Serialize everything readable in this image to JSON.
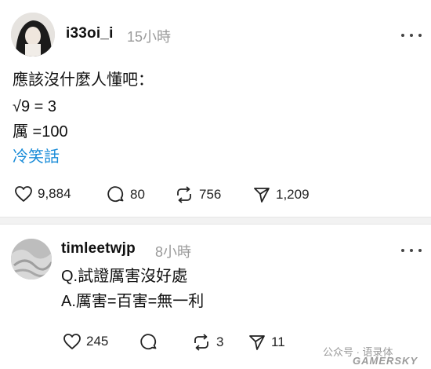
{
  "posts": [
    {
      "username": "i33oi_i",
      "time": "15小時",
      "lines": [
        "應該沒什麼人懂吧：",
        "√9 = 3",
        "厲 =100"
      ],
      "tag": "冷笑話",
      "actions": {
        "likes": "9,884",
        "comments": "80",
        "reposts": "756",
        "shares": "1,209"
      }
    },
    {
      "username": "timleetwjp",
      "time": "8小時",
      "lines": [
        "Q.試證厲害沒好處",
        "A.厲害=百害=無一利"
      ],
      "actions": {
        "likes": "245",
        "comments": "",
        "reposts": "3",
        "shares": "11"
      }
    }
  ],
  "watermark": {
    "source": "公众号 · 语录体",
    "brand": "GAMERSKY"
  },
  "icons": [
    "more-icon",
    "heart-icon",
    "comment-icon",
    "repost-icon",
    "share-icon"
  ]
}
